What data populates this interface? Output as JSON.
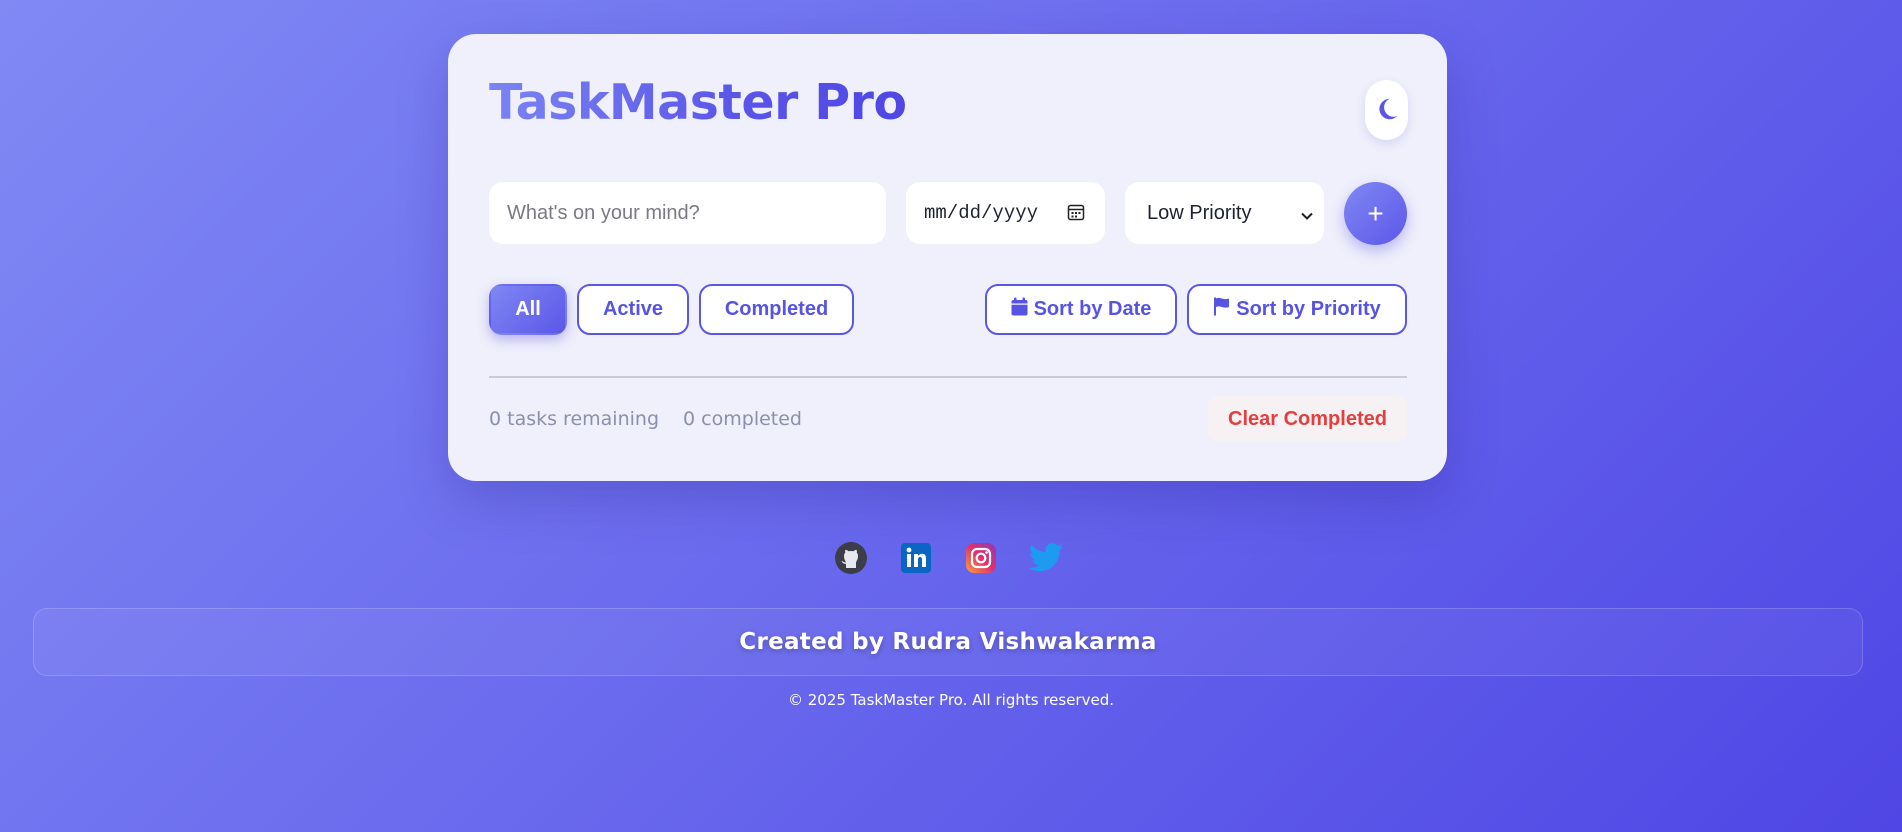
{
  "app": {
    "title": "TaskMaster Pro"
  },
  "form": {
    "task_placeholder": "What's on your mind?",
    "date_placeholder": "mm/dd/yyyy",
    "priority_selected": "Low Priority",
    "add_label": "+"
  },
  "filters": {
    "all": "All",
    "active": "Active",
    "completed": "Completed"
  },
  "sort": {
    "by_date": "Sort by Date",
    "by_priority": "Sort by Priority"
  },
  "stats": {
    "remaining": "0 tasks remaining",
    "completed": "0 completed",
    "clear_label": "Clear Completed"
  },
  "socials": [
    "github-icon",
    "linkedin-icon",
    "instagram-icon",
    "twitter-icon"
  ],
  "footer": {
    "credit": "Created by Rudra Vishwakarma",
    "copyright": "© 2025 TaskMaster Pro. All rights reserved."
  },
  "colors": {
    "accent": "#5b57e6",
    "danger": "#e53e3e"
  }
}
